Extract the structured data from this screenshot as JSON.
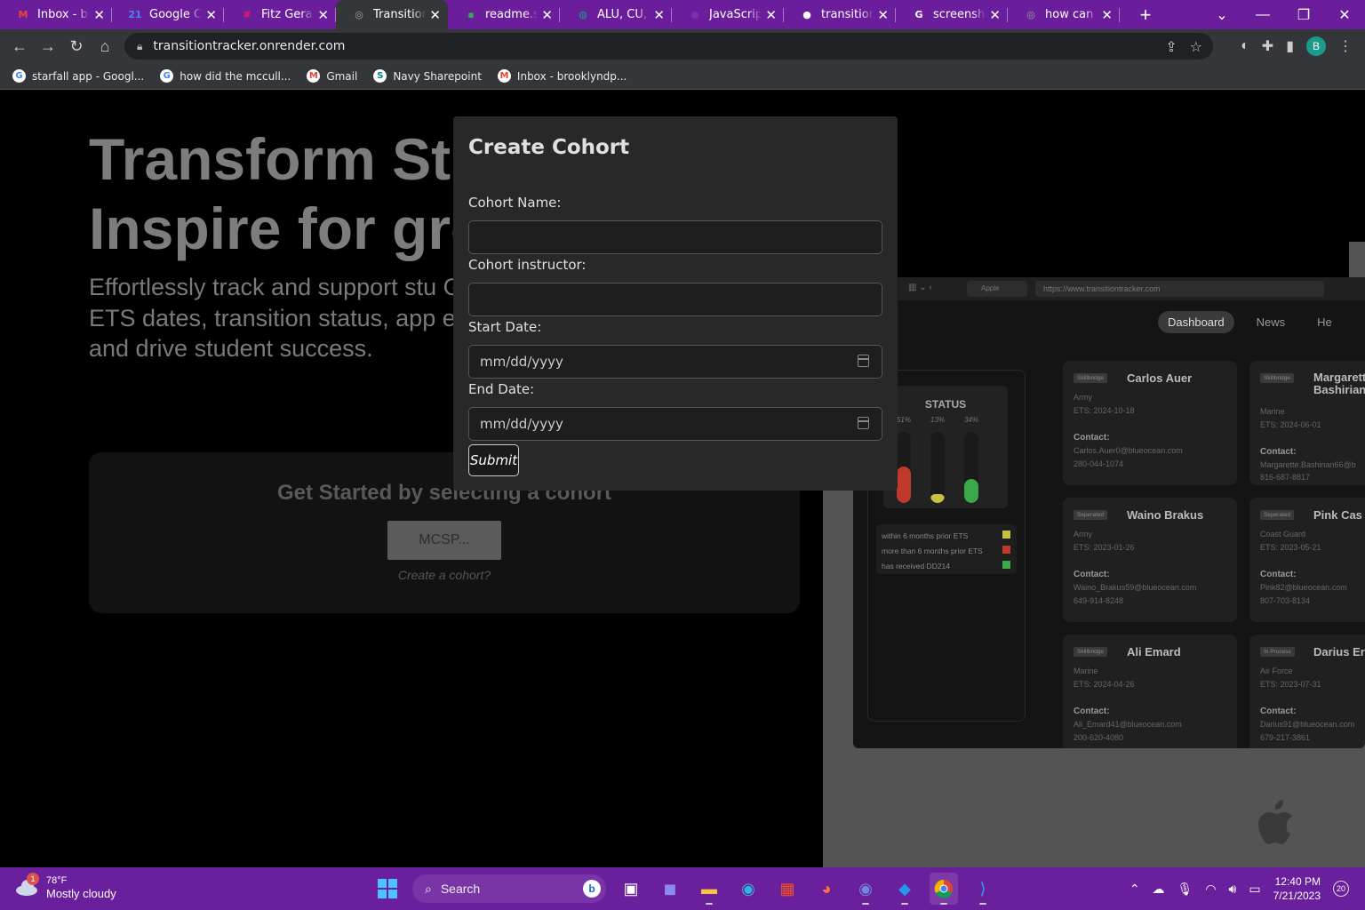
{
  "browser": {
    "tabs": [
      {
        "title": "Inbox - bro",
        "icon": "gmail-icon",
        "color": "#ea4335",
        "glyph": "M"
      },
      {
        "title": "Google Cale",
        "icon": "google-calendar-icon",
        "color": "#4285f4",
        "glyph": "21"
      },
      {
        "title": "Fitz Gerald",
        "icon": "slack-icon",
        "color": "#e01e5a",
        "glyph": "#"
      },
      {
        "title": "Transition Tr",
        "icon": "globe-icon",
        "color": "#9aa0a6",
        "glyph": "◎"
      },
      {
        "title": "readme.so",
        "icon": "readme-icon",
        "color": "#34a853",
        "glyph": "▪"
      },
      {
        "title": "ALU, CU, M",
        "icon": "chatgpt-icon",
        "color": "#10a37f",
        "glyph": "◍"
      },
      {
        "title": "JavaScript &",
        "icon": "javascript-icon",
        "color": "#7b2fb5",
        "glyph": "●"
      },
      {
        "title": "transition-tr",
        "icon": "github-icon",
        "color": "#ffffff",
        "glyph": "●"
      },
      {
        "title": "screenshot",
        "icon": "google-icon",
        "color": "#ffffff",
        "glyph": "G"
      },
      {
        "title": "how can yo",
        "icon": "globe-icon",
        "color": "#9aa0a6",
        "glyph": "◎"
      }
    ],
    "active_tab": 3,
    "new_tab_glyph": "+",
    "url": "transitiontracker.onrender.com",
    "profile_initial": "B",
    "bookmarks": [
      {
        "label": "starfall app - Googl...",
        "icon": "google-icon"
      },
      {
        "label": "how did the mccull...",
        "icon": "google-icon"
      },
      {
        "label": "Gmail",
        "icon": "gmail-icon"
      },
      {
        "label": "Navy Sharepoint",
        "icon": "sharepoint-icon"
      },
      {
        "label": "Inbox - brooklyndp...",
        "icon": "gmail-icon"
      }
    ]
  },
  "page": {
    "hero_line1": "Transform Stu",
    "hero_line2": "Inspire for gre",
    "description": "Effortlessly track and support stu Galvanize's user-friendly platforn ETS dates, transition status, app empowering you to make inform and drive student success.",
    "get_started": "Get Started by selecting a cohort",
    "cohort_button": "MCSP...",
    "create_cohort_link": "Create a cohort?"
  },
  "showcase": {
    "url": "https://www.transitiontracker.com",
    "apple_tab": "Apple",
    "nav": [
      "Dashboard",
      "News",
      "He"
    ],
    "status_title": "STATUS",
    "status_bars": [
      {
        "pct": "51%",
        "value": 0.51,
        "color": "#c0392b"
      },
      {
        "pct": "13%",
        "value": 0.13,
        "color": "#c8c040"
      },
      {
        "pct": "34%",
        "value": 0.34,
        "color": "#3aa84a"
      }
    ],
    "legend": [
      {
        "label": "within 6 months prior ETS",
        "color": "#c8c040"
      },
      {
        "label": "more than 6 months prior ETS",
        "color": "#c0392b"
      },
      {
        "label": "has received DD214",
        "color": "#3aa84a"
      }
    ],
    "cards": [
      {
        "badge": "Skillbridge",
        "name": "Carlos Auer",
        "branch": "Army",
        "ets": "ETS: 2024-10-18",
        "contact": "Contact:",
        "email": "Carlos.Auer0@blueocean.com",
        "phone": "280-044-1074"
      },
      {
        "badge": "Skillbridge",
        "name": "Margarett Bashirian",
        "branch": "Marine",
        "ets": "ETS: 2024-06-01",
        "contact": "Contact:",
        "email": "Margarette.Bashirian66@b",
        "phone": "816-687-8817"
      },
      {
        "badge": "Seperated",
        "name": "Waino Brakus",
        "branch": "Army",
        "ets": "ETS: 2023-01-26",
        "contact": "Contact:",
        "email": "Waino_Brakus59@blueocean.com",
        "phone": "649-914-8248"
      },
      {
        "badge": "Seperated",
        "name": "Pink Cas",
        "branch": "Coast Guard",
        "ets": "ETS: 2023-05-21",
        "contact": "Contact:",
        "email": "Pink82@blueocean.com",
        "phone": "807-703-8134"
      },
      {
        "badge": "Skillbridge",
        "name": "Ali Emard",
        "branch": "Marine",
        "ets": "ETS: 2024-04-26",
        "contact": "Contact:",
        "email": "Ali_Emard41@blueocean.com",
        "phone": "200-620-4080"
      },
      {
        "badge": "In Process",
        "name": "Darius Er",
        "branch": "Air Force",
        "ets": "ETS: 2023-07-31",
        "contact": "Contact:",
        "email": "Darius91@blueocean.com",
        "phone": "679-217-3861"
      }
    ]
  },
  "modal": {
    "title": "Create Cohort",
    "name_label": "Cohort Name:",
    "name_value": "",
    "instructor_label": "Cohort instructor:",
    "instructor_value": "",
    "start_label": "Start Date:",
    "start_placeholder": "mm/dd/yyyy",
    "end_label": "End Date:",
    "end_placeholder": "mm/dd/yyyy",
    "submit": "Submit"
  },
  "taskbar": {
    "weather_badge": "1",
    "temperature": "78°F",
    "condition": "Mostly cloudy",
    "search": "Search",
    "time": "12:40 PM",
    "date": "7/21/2023",
    "notifications": "20"
  }
}
